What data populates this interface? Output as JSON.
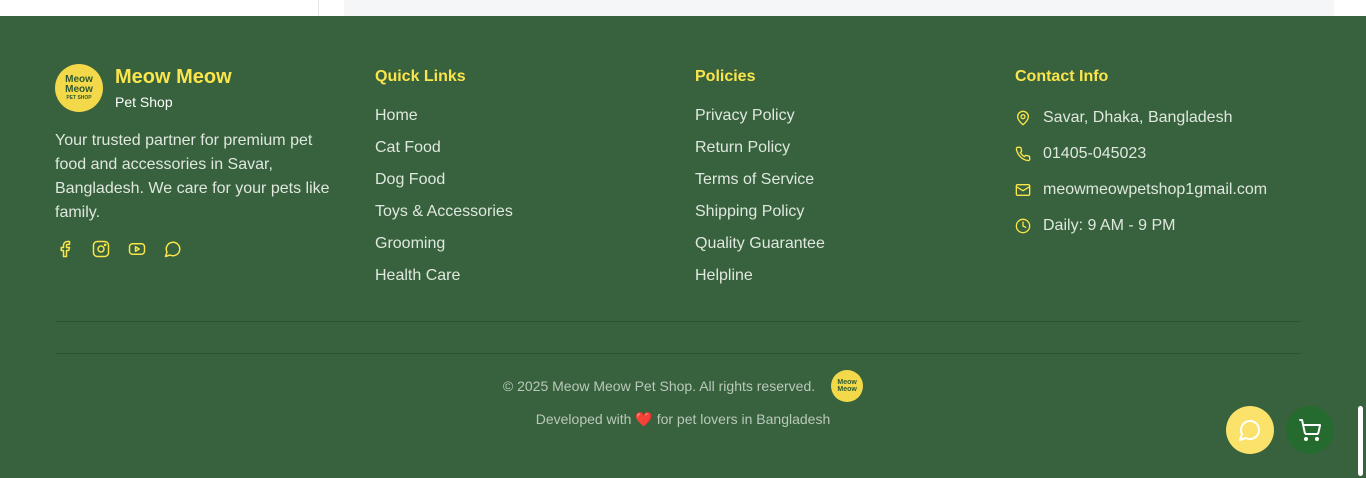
{
  "brand": {
    "logo_text_1": "Meow",
    "logo_text_2": "Meow",
    "logo_text_3": "PET SHOP",
    "name": "Meow Meow",
    "subtitle": "Pet Shop",
    "description": "Your trusted partner for premium pet food and accessories in Savar, Bangladesh. We care for your pets like family.",
    "socials": [
      "facebook-icon",
      "instagram-icon",
      "youtube-icon",
      "chat-icon"
    ]
  },
  "quick_links": {
    "title": "Quick Links",
    "items": [
      "Home",
      "Cat Food",
      "Dog Food",
      "Toys & Accessories",
      "Grooming",
      "Health Care"
    ]
  },
  "policies": {
    "title": "Policies",
    "items": [
      "Privacy Policy",
      "Return Policy",
      "Terms of Service",
      "Shipping Policy",
      "Quality Guarantee",
      "Helpline"
    ]
  },
  "contact": {
    "title": "Contact Info",
    "address": "Savar, Dhaka, Bangladesh",
    "phone": "01405-045023",
    "email": "meowmeowpetshop1gmail.com",
    "hours": "Daily: 9 AM - 9 PM"
  },
  "bottom": {
    "copyright": "© 2025 Meow Meow Pet Shop. All rights reserved.",
    "dev_prefix": "Developed with",
    "heart": "❤️",
    "dev_suffix": "for pet lovers in Bangladesh"
  },
  "colors": {
    "footer_bg": "#38613d",
    "accent_yellow": "#fbe54c",
    "cart_green": "#256b30"
  }
}
